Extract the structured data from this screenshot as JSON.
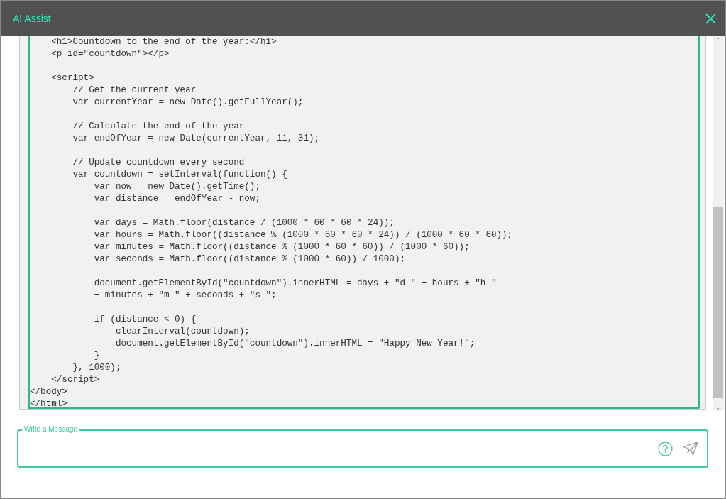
{
  "window": {
    "title": "AI Assist"
  },
  "code": "    <h1>Countdown to the end of the year:</h1>\n    <p id=\"countdown\"></p>\n\n    <script>\n        // Get the current year\n        var currentYear = new Date().getFullYear();\n\n        // Calculate the end of the year\n        var endOfYear = new Date(currentYear, 11, 31);\n\n        // Update countdown every second\n        var countdown = setInterval(function() {\n            var now = new Date().getTime();\n            var distance = endOfYear - now;\n\n            var days = Math.floor(distance / (1000 * 60 * 60 * 24));\n            var hours = Math.floor((distance % (1000 * 60 * 60 * 24)) / (1000 * 60 * 60));\n            var minutes = Math.floor((distance % (1000 * 60 * 60)) / (1000 * 60));\n            var seconds = Math.floor((distance % (1000 * 60)) / 1000);\n\n            document.getElementById(\"countdown\").innerHTML = days + \"d \" + hours + \"h \"\n            + minutes + \"m \" + seconds + \"s \";\n\n            if (distance < 0) {\n                clearInterval(countdown);\n                document.getElementById(\"countdown\").innerHTML = \"Happy New Year!\";\n            }\n        }, 1000);\n    </script>\n</body>\n</html>",
  "message": {
    "label": "Write a Message"
  }
}
